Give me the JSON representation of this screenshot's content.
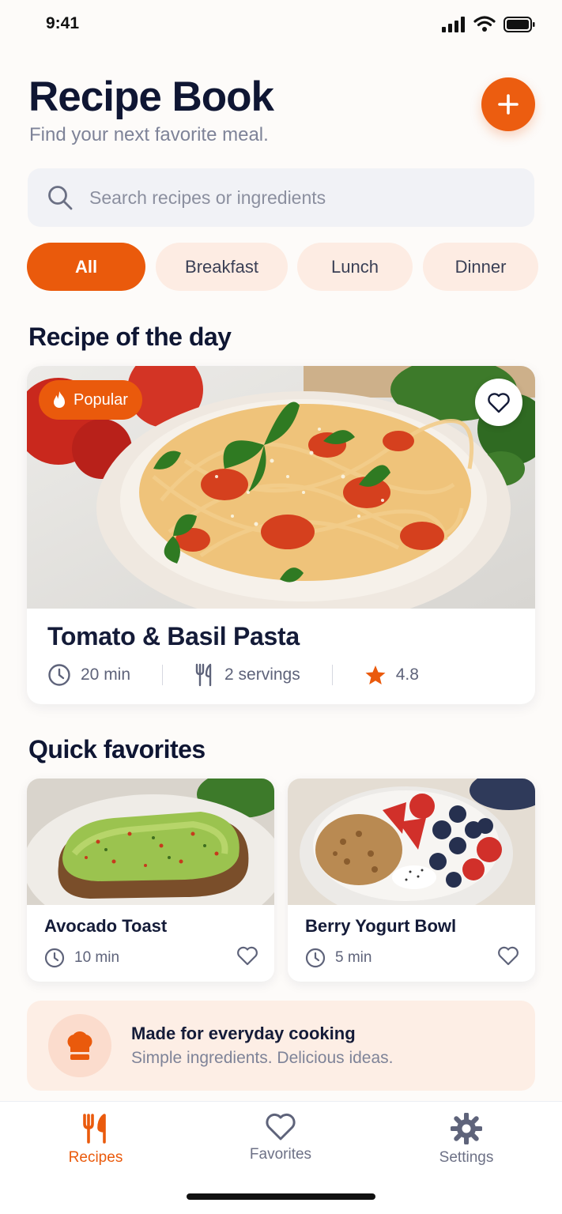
{
  "status_bar": {
    "time": "9:41"
  },
  "header": {
    "title": "Recipe Book",
    "subtitle": "Find your next favorite meal."
  },
  "search": {
    "placeholder": "Search recipes or ingredients"
  },
  "categories": [
    "All",
    "Breakfast",
    "Lunch",
    "Dinner"
  ],
  "recipe_of_day": {
    "section_title": "Recipe of the day",
    "badge": "Popular",
    "title": "Tomato & Basil Pasta",
    "time": "20 min",
    "servings": "2 servings",
    "rating": "4.8"
  },
  "quick_favorites": {
    "section_title": "Quick favorites",
    "items": [
      {
        "title": "Avocado Toast",
        "time": "10 min"
      },
      {
        "title": "Berry Yogurt Bowl",
        "time": "5 min"
      }
    ]
  },
  "banner": {
    "title": "Made for everyday cooking",
    "subtitle": "Simple ingredients. Delicious ideas."
  },
  "tabs": [
    {
      "label": "Recipes",
      "icon": "fork-knife-icon"
    },
    {
      "label": "Favorites",
      "icon": "heart-icon"
    },
    {
      "label": "Settings",
      "icon": "gear-icon"
    }
  ],
  "colors": {
    "accent": "#ea5a0c",
    "text": "#141b38",
    "muted": "#7e8398"
  }
}
